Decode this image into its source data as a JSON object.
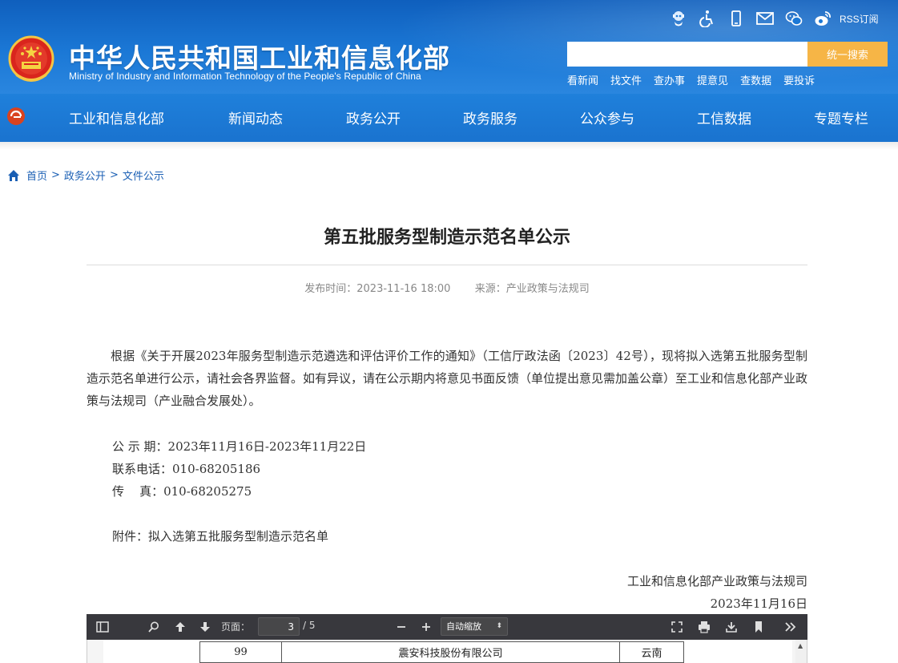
{
  "header": {
    "title": "中华人民共和国工业和信息化部",
    "subtitle": "Ministry of Industry and Information Technology of the People's Republic of China",
    "util_icons": [
      "robot-assistant-icon",
      "accessibility-icon",
      "mobile-icon",
      "mail-icon",
      "wechat-icon",
      "weibo-icon"
    ],
    "rss_label": "RSS订阅",
    "search": {
      "value": "",
      "button_label": "统一搜索"
    },
    "quick_links": [
      "看新闻",
      "找文件",
      "查办事",
      "提意见",
      "查数据",
      "要投诉"
    ]
  },
  "nav": {
    "items": [
      "工业和信息化部",
      "新闻动态",
      "政务公开",
      "政务服务",
      "公众参与",
      "工信数据",
      "专题专栏"
    ]
  },
  "breadcrumb": {
    "items": [
      "首页",
      "政务公开",
      "文件公示"
    ],
    "separator": ">"
  },
  "article": {
    "title": "第五批服务型制造示范名单公示",
    "publish_label": "发布时间：",
    "publish_time": "2023-11-16 18:00",
    "source_label": "来源：",
    "source": "产业政策与法规司",
    "body": "根据《关于开展2023年服务型制造示范遴选和评估评价工作的通知》（工信厅政法函〔2023〕42号），现将拟入选第五批服务型制造示范名单进行公示，请社会各界监督。如有异议，请在公示期内将意见书面反馈（单位提出意见需加盖公章）至工业和信息化部产业政策与法规司（产业融合发展处）。",
    "period": "公 示 期：2023年11月16日-2023年11月22日",
    "phone": "联系电话：010-68205186",
    "fax": "传    真：010-68205275",
    "attachment": "附件：拟入选第五批服务型制造示范名单",
    "sign_org": "工业和信息化部产业政策与法规司",
    "sign_date": "2023年11月16日"
  },
  "pdf_viewer": {
    "page_label": "页面：",
    "current_page": "3",
    "total_pages": "/ 5",
    "zoom": "自动缩放",
    "visible_row": {
      "no": "99",
      "company": "震安科技股份有限公司",
      "region": "云南"
    }
  },
  "colors": {
    "header_blue": "#1b78d6",
    "nav_blue": "#1a73cf",
    "search_button": "#f6b546",
    "link_blue": "#1a5fb4",
    "pdf_toolbar": "#38383d"
  }
}
